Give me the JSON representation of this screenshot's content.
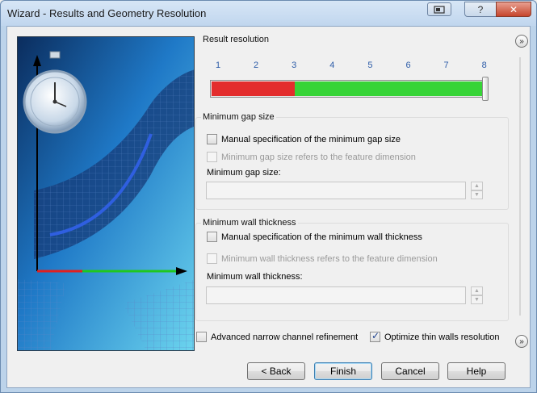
{
  "window": {
    "title": "Wizard - Results and Geometry Resolution",
    "help_label": "?",
    "close_label": "✕"
  },
  "result_resolution": {
    "label": "Result resolution",
    "ticks": [
      "1",
      "2",
      "3",
      "4",
      "5",
      "6",
      "7",
      "8"
    ],
    "value": 8,
    "red_until": 3,
    "colors": {
      "low": "#e32d2d",
      "high": "#37d437"
    }
  },
  "min_gap": {
    "group_label": "Minimum gap size",
    "manual_label": "Manual specification of the minimum gap size",
    "manual_checked": false,
    "feature_label": "Minimum gap size refers to the feature dimension",
    "feature_checked": false,
    "field_label": "Minimum gap size:",
    "field_value": ""
  },
  "min_wall": {
    "group_label": "Minimum wall thickness",
    "manual_label": "Manual specification of the minimum wall thickness",
    "manual_checked": false,
    "feature_label": "Minimum wall thickness refers to the feature dimension",
    "feature_checked": false,
    "field_label": "Minimum wall thickness:",
    "field_value": ""
  },
  "options": {
    "narrow_channel_label": "Advanced narrow channel refinement",
    "narrow_channel_checked": false,
    "thin_walls_label": "Optimize thin walls resolution",
    "thin_walls_checked": true
  },
  "buttons": {
    "back": "< Back",
    "finish": "Finish",
    "cancel": "Cancel",
    "help": "Help"
  },
  "icons": {
    "expand_top": "double-chevron-icon",
    "expand_bottom": "double-chevron-icon",
    "stopwatch": "stopwatch-icon"
  }
}
